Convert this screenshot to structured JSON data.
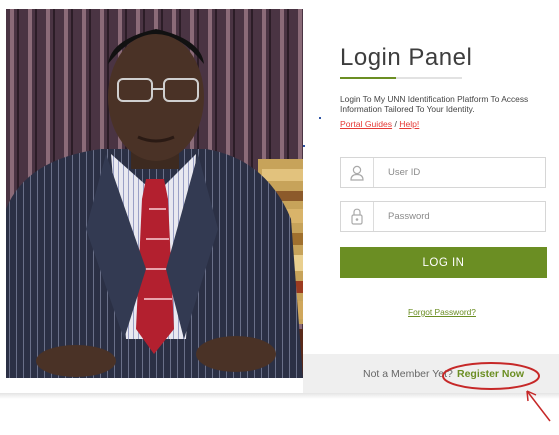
{
  "login": {
    "title": "Login Panel",
    "intro": "Login To My UNN Identification Platform To Access Information Tailored To Your Identity.",
    "portal_guides_link": "Portal Guides",
    "separator": "/",
    "help_link": "Help!",
    "user_id_placeholder": "User ID",
    "password_placeholder": "Password",
    "login_button": "LOG IN",
    "forgot_password_link": "Forgot Password?",
    "not_member_text": "Not a Member Yet?",
    "register_link": "Register Now"
  },
  "colors": {
    "accent_green": "#6b8e23",
    "link_red": "#e53935",
    "annotation_red": "#c62828",
    "footer_bg": "#efefef"
  },
  "icons": {
    "user_field": "user-icon",
    "password_field": "lock-icon",
    "annotation": "arrow-icon"
  }
}
